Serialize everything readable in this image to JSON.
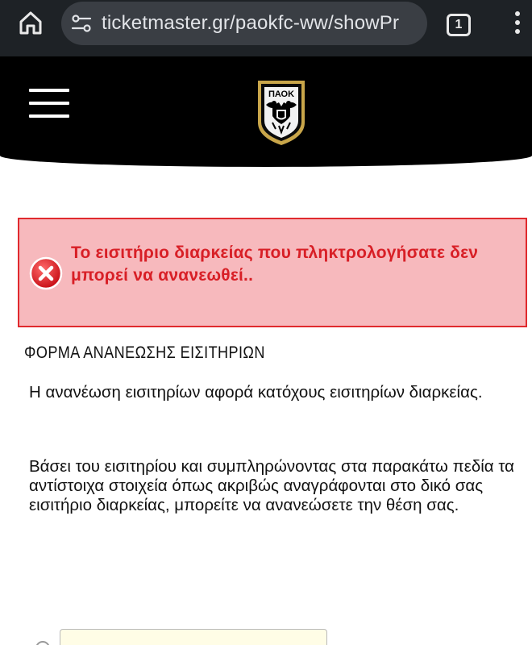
{
  "browser": {
    "url": "ticketmaster.gr/paokfc-ww/showPr",
    "tab_count": "1",
    "icons": {
      "home": "home-icon",
      "site_info": "tune-icon",
      "tabs": "tabs-icon",
      "menu": "more-vert-icon"
    }
  },
  "header": {
    "logo_text": "ΠΑΟΚ",
    "logo_year": "1926",
    "background": "#000000"
  },
  "alert": {
    "message": "Το εισιτήριο διαρκείας που πληκτρολογήσατε δεν μπορεί να ανανεωθεί..",
    "color": "#d81f26",
    "background": "#f7b9bd",
    "icon": "error-x-icon"
  },
  "form": {
    "title": "ΦΟΡΜΑ ΑΝΑΝΕΩΣΗΣ ΕΙΣΙΤΗΡΙΩΝ",
    "intro": "Η ανανέωση εισιτηρίων αφορά κατόχους εισιτηρίων διαρκείας.",
    "instructions": "Βάσει του εισιτηρίου και συμπληρώνοντας στα παρακάτω πεδία τα αντίστοιχα στοιχεία όπως ακριβώς αναγράφονται στο δικό σας εισιτήριο διαρκείας, μπορείτε να ανανεώσετε την θέση σας."
  }
}
